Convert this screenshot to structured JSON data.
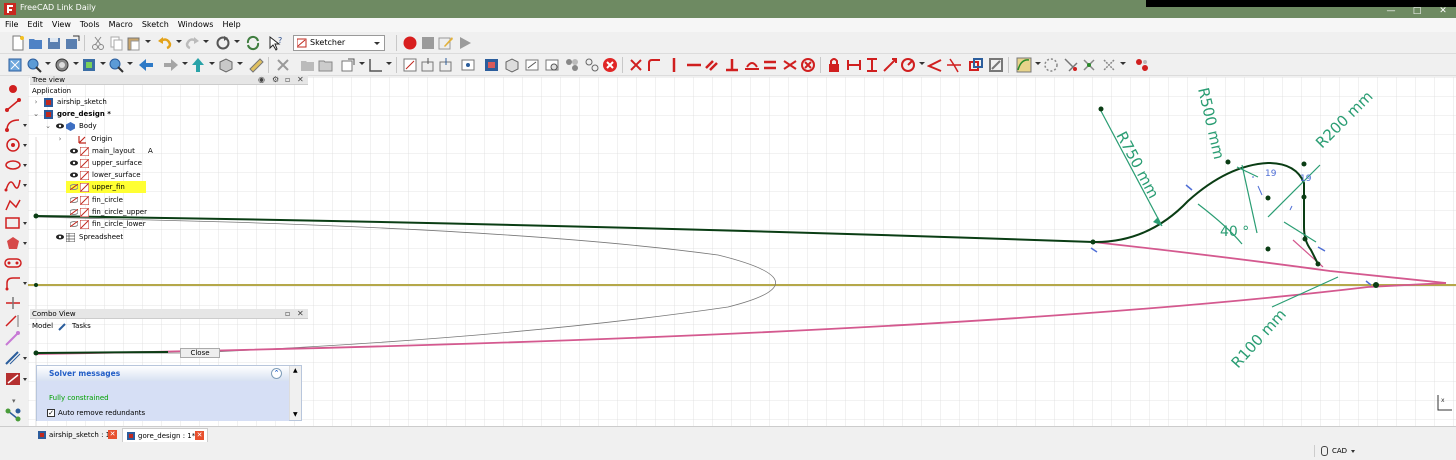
{
  "window": {
    "title": "FreeCAD Link Daily"
  },
  "menu": [
    "File",
    "Edit",
    "View",
    "Tools",
    "Macro",
    "Sketch",
    "Windows",
    "Help"
  ],
  "workbench": {
    "selected": "Sketcher"
  },
  "tree": {
    "header": "Tree view",
    "root": "Application",
    "items": [
      {
        "label": "airship_sketch",
        "level": 0,
        "bold": false,
        "expander": ">"
      },
      {
        "label": "gore_design *",
        "level": 0,
        "bold": true,
        "expander": "v"
      },
      {
        "label": "Body",
        "level": 1,
        "bold": false,
        "expander": "v"
      },
      {
        "label": "Origin",
        "level": 2,
        "bold": false,
        "expander": ">"
      },
      {
        "label": "main_layout",
        "level": 2,
        "bold": false,
        "suffix": "A"
      },
      {
        "label": "upper_surface",
        "level": 2,
        "bold": false
      },
      {
        "label": "lower_surface",
        "level": 2,
        "bold": false
      },
      {
        "label": "upper_fin",
        "level": 2,
        "bold": false,
        "highlight": true
      },
      {
        "label": "fin_circle",
        "level": 2,
        "bold": false
      },
      {
        "label": "fin_circle_upper",
        "level": 2,
        "bold": false
      },
      {
        "label": "fin_circle_lower",
        "level": 2,
        "bold": false
      },
      {
        "label": "Spreadsheet",
        "level": 1,
        "bold": false
      }
    ]
  },
  "combo": {
    "header": "Combo View",
    "tabs": [
      "Model",
      "Tasks"
    ],
    "close_label": "Close",
    "solver": {
      "title": "Solver messages",
      "status": "Fully constrained",
      "auto_remove": "Auto remove redundants",
      "auto_remove_checked": true
    }
  },
  "sketch": {
    "dimensions": [
      "R750 mm",
      "R500 mm",
      "R200 mm",
      "R100 mm",
      "40 °",
      "19",
      "19"
    ],
    "colors": {
      "constrained": "#0a3d14",
      "dimension": "#2a9d73",
      "construction": "#d4598f",
      "axis": "#b5a84a",
      "grid": "#dcdcdc"
    }
  },
  "doc_tabs": [
    {
      "label": "airship_sketch : 1",
      "active": false
    },
    {
      "label": "gore_design : 1*",
      "active": true
    }
  ],
  "status": {
    "navigation": "CAD"
  }
}
